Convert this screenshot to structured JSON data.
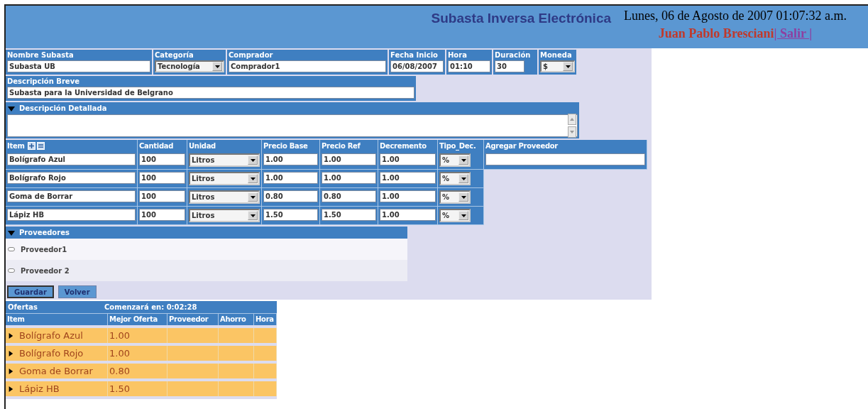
{
  "header": {
    "title": "Subasta Inversa Electrónica",
    "datetime": "Lunes, 06 de Agosto de 2007 01:07:32 a.m.",
    "user": "Juan Pablo Bresciani",
    "logout": "| Salir |"
  },
  "general_fields": [
    {
      "label": "Nombre Subasta",
      "value": "Subasta UB",
      "kind": "text"
    },
    {
      "label": "Categoría",
      "value": "Tecnología",
      "kind": "select"
    },
    {
      "label": "Comprador",
      "value": "Comprador1",
      "kind": "text"
    },
    {
      "label": "Fecha Inicio",
      "value": "06/08/2007",
      "kind": "text"
    },
    {
      "label": "Hora",
      "value": "01:10",
      "kind": "text"
    },
    {
      "label": "Duración",
      "value": "30",
      "kind": "text"
    },
    {
      "label": "Moneda",
      "value": "$",
      "kind": "select"
    }
  ],
  "brief_description": {
    "label": "Descripción Breve",
    "value": "Subasta para la Universidad de Belgrano"
  },
  "detailed_description": {
    "label": "Descripción Detallada",
    "expanded": true
  },
  "items_table": {
    "columns": [
      "Item",
      "Cantidad",
      "Unidad",
      "Precio Base",
      "Precio Ref",
      "Decremento",
      "Tipo_Dec.",
      "Agregar Proveedor"
    ],
    "rows": [
      {
        "item": "Bolígrafo Azul",
        "quantity": "100",
        "unit": "Litros",
        "base_price": "1.00",
        "ref_price": "1.00",
        "decrement": "1.00",
        "dec_type": "%"
      },
      {
        "item": "Bolígrafo Rojo",
        "quantity": "100",
        "unit": "Litros",
        "base_price": "1.00",
        "ref_price": "1.00",
        "decrement": "1.00",
        "dec_type": "%"
      },
      {
        "item": "Goma de Borrar",
        "quantity": "100",
        "unit": "Litros",
        "base_price": "0.80",
        "ref_price": "0.80",
        "decrement": "1.00",
        "dec_type": "%"
      },
      {
        "item": "Lápiz HB",
        "quantity": "100",
        "unit": "Litros",
        "base_price": "1.50",
        "ref_price": "1.50",
        "decrement": "1.00",
        "dec_type": "%"
      }
    ]
  },
  "suppliers": {
    "label": "Proveedores",
    "expanded": true,
    "items": [
      {
        "name": "Proveedor1"
      },
      {
        "name": "Proveedor 2"
      }
    ]
  },
  "buttons": [
    {
      "label": "Guardar",
      "focused": true
    },
    {
      "label": "Volver",
      "focused": false
    }
  ],
  "offers": {
    "title": "Ofertas",
    "countdown": "Comenzará en: 0:02:28",
    "columns": [
      "Item",
      "Mejor Oferta",
      "Proveedor",
      "Ahorro",
      "Hora"
    ],
    "rows": [
      {
        "item": "Bolígrafo Azul",
        "best_offer": "1.00",
        "expanded": false
      },
      {
        "item": "Bolígrafo Rojo",
        "best_offer": "1.00",
        "expanded": false
      },
      {
        "item": "Goma de Borrar",
        "best_offer": "0.80",
        "expanded": false
      },
      {
        "item": "Lápiz HB",
        "best_offer": "1.50",
        "expanded": false
      }
    ]
  }
}
